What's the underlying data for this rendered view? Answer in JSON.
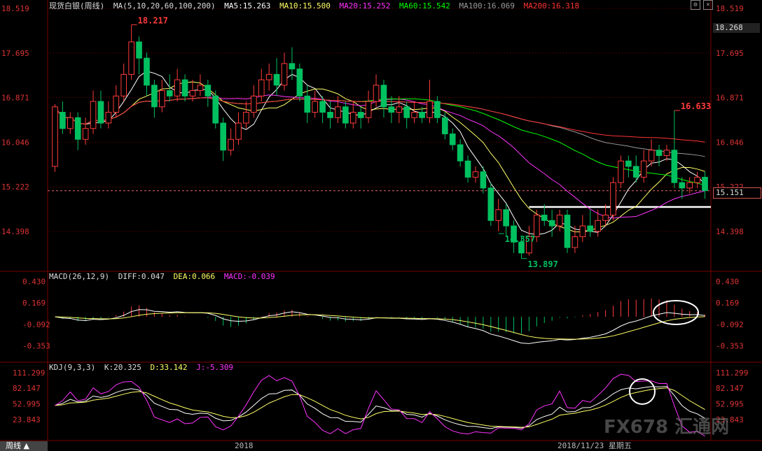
{
  "header": {
    "instrument": "现货白银(周线)",
    "ma_label": "MA(5,10,20,60,100,200)",
    "ma5": "MA5:15.263",
    "ma10": "MA10:15.500",
    "ma20": "MA20:15.252",
    "ma60": "MA60:15.542",
    "ma100": "MA100:16.069",
    "ma200": "MA200:16.318"
  },
  "macd_header": {
    "label": "MACD(26,12,9)",
    "diff": "DIFF:0.047",
    "dea": "DEA:0.066",
    "macd": "MACD:-0.039"
  },
  "kdj_header": {
    "label": "KDJ(9,3,3)",
    "k": "K:20.325",
    "d": "D:33.142",
    "j": "J:-5.309"
  },
  "price_tag": "15.151",
  "crosshair_value": "18.268",
  "bottom_tab": "周线 ▲",
  "xaxis": {
    "year": "2018",
    "date": "2018/11/23 星期五"
  },
  "watermark": "FX678 汇通网",
  "colors": {
    "up": "#ff3b3b",
    "down": "#00c060",
    "ma5": "#ffffff",
    "ma10": "#ffff66",
    "ma20": "#ff33ff",
    "ma60": "#00ff00",
    "ma100": "#999999",
    "ma200": "#ff3333",
    "grid": "#7a0000"
  },
  "chart_data": [
    {
      "type": "candlestick",
      "title": "现货白银(周线)",
      "yticks": [
        18.519,
        17.695,
        16.871,
        16.046,
        15.222,
        14.398
      ],
      "ylim": [
        13.7,
        18.519
      ],
      "annotations": [
        {
          "text": "18.217",
          "value": 18.217
        },
        {
          "text": "14.357",
          "value": 14.357
        },
        {
          "text": "13.897",
          "value": 13.897
        },
        {
          "text": "16.633",
          "value": 16.633
        }
      ],
      "support_line": 14.85,
      "reference_price": 15.151,
      "candles": [
        [
          15.6,
          16.7,
          16.75,
          15.5
        ],
        [
          16.6,
          16.3,
          16.8,
          16.2
        ],
        [
          16.3,
          16.5,
          16.6,
          16.2
        ],
        [
          16.5,
          16.1,
          16.6,
          15.9
        ],
        [
          16.1,
          16.3,
          16.5,
          16.0
        ],
        [
          16.3,
          16.8,
          17.0,
          16.2
        ],
        [
          16.8,
          16.4,
          17.0,
          16.3
        ],
        [
          16.4,
          16.6,
          16.8,
          16.3
        ],
        [
          16.6,
          16.9,
          17.1,
          16.5
        ],
        [
          16.9,
          17.3,
          17.5,
          16.8
        ],
        [
          17.3,
          17.9,
          18.217,
          17.2
        ],
        [
          17.9,
          17.6,
          18.0,
          17.3
        ],
        [
          17.6,
          17.1,
          17.7,
          16.9
        ],
        [
          17.1,
          16.7,
          17.2,
          16.5
        ],
        [
          16.7,
          17.0,
          17.2,
          16.6
        ],
        [
          17.0,
          16.9,
          17.3,
          16.8
        ],
        [
          16.9,
          17.2,
          17.4,
          16.8
        ],
        [
          17.2,
          16.9,
          17.3,
          16.8
        ],
        [
          16.9,
          17.0,
          17.2,
          16.8
        ],
        [
          17.0,
          17.1,
          17.3,
          16.9
        ],
        [
          17.1,
          16.9,
          17.2,
          16.7
        ],
        [
          16.9,
          16.4,
          17.0,
          16.3
        ],
        [
          16.4,
          15.9,
          16.5,
          15.7
        ],
        [
          15.9,
          16.1,
          16.3,
          15.8
        ],
        [
          16.1,
          16.4,
          16.6,
          16.0
        ],
        [
          16.4,
          16.6,
          16.8,
          16.3
        ],
        [
          16.6,
          16.9,
          17.1,
          16.5
        ],
        [
          16.9,
          17.2,
          17.4,
          16.8
        ],
        [
          17.2,
          17.3,
          17.5,
          17.0
        ],
        [
          17.3,
          17.1,
          17.6,
          16.9
        ],
        [
          17.1,
          17.5,
          17.7,
          17.0
        ],
        [
          17.5,
          17.4,
          17.8,
          17.2
        ],
        [
          17.4,
          16.9,
          17.5,
          16.8
        ],
        [
          16.9,
          16.6,
          17.1,
          16.4
        ],
        [
          16.6,
          16.8,
          17.0,
          16.5
        ],
        [
          16.8,
          16.6,
          16.9,
          16.4
        ],
        [
          16.6,
          16.5,
          16.8,
          16.3
        ],
        [
          16.5,
          16.7,
          16.9,
          16.4
        ],
        [
          16.7,
          16.4,
          16.8,
          16.3
        ],
        [
          16.4,
          16.6,
          16.8,
          16.3
        ],
        [
          16.6,
          16.5,
          16.7,
          16.3
        ],
        [
          16.5,
          16.8,
          17.0,
          16.4
        ],
        [
          16.8,
          17.1,
          17.3,
          16.7
        ],
        [
          17.1,
          16.7,
          17.2,
          16.5
        ],
        [
          16.7,
          16.6,
          16.9,
          16.4
        ],
        [
          16.6,
          16.7,
          16.9,
          16.4
        ],
        [
          16.7,
          16.5,
          16.8,
          16.3
        ],
        [
          16.5,
          16.6,
          16.8,
          16.4
        ],
        [
          16.6,
          16.5,
          16.7,
          16.4
        ],
        [
          16.5,
          16.8,
          17.2,
          16.4
        ],
        [
          16.8,
          16.5,
          16.9,
          16.4
        ],
        [
          16.5,
          16.2,
          16.6,
          16.1
        ],
        [
          16.2,
          16.0,
          16.3,
          15.9
        ],
        [
          16.0,
          15.7,
          16.1,
          15.6
        ],
        [
          15.7,
          15.4,
          15.8,
          15.3
        ],
        [
          15.4,
          15.5,
          15.6,
          15.3
        ],
        [
          15.5,
          15.2,
          15.6,
          15.1
        ],
        [
          15.2,
          14.6,
          15.3,
          14.5
        ],
        [
          14.6,
          14.8,
          15.0,
          14.4
        ],
        [
          14.8,
          14.5,
          14.9,
          14.3
        ],
        [
          14.5,
          14.2,
          14.6,
          14.0
        ],
        [
          14.2,
          14.0,
          14.3,
          13.9
        ],
        [
          14.0,
          14.3,
          14.5,
          13.95
        ],
        [
          14.3,
          14.7,
          14.8,
          14.2
        ],
        [
          14.7,
          14.6,
          14.9,
          14.5
        ],
        [
          14.6,
          14.5,
          14.8,
          14.3
        ],
        [
          14.5,
          14.7,
          14.8,
          14.4
        ],
        [
          14.7,
          14.1,
          14.8,
          14.0
        ],
        [
          14.1,
          14.3,
          14.5,
          14.0
        ],
        [
          14.3,
          14.5,
          14.7,
          14.2
        ],
        [
          14.5,
          14.4,
          14.8,
          14.3
        ],
        [
          14.4,
          14.6,
          14.8,
          14.3
        ],
        [
          14.6,
          14.7,
          14.9,
          14.5
        ],
        [
          14.7,
          15.3,
          15.4,
          14.6
        ],
        [
          15.3,
          15.7,
          15.8,
          15.2
        ],
        [
          15.7,
          15.6,
          15.8,
          15.4
        ],
        [
          15.6,
          15.4,
          15.8,
          15.3
        ],
        [
          15.4,
          15.7,
          15.9,
          15.3
        ],
        [
          15.7,
          15.9,
          16.1,
          15.6
        ],
        [
          15.9,
          15.8,
          16.0,
          15.6
        ],
        [
          15.8,
          15.9,
          16.0,
          15.7
        ],
        [
          15.9,
          15.3,
          16.633,
          15.2
        ],
        [
          15.3,
          15.2,
          15.4,
          15.0
        ],
        [
          15.2,
          15.3,
          15.4,
          15.1
        ],
        [
          15.3,
          15.4,
          15.5,
          15.2
        ],
        [
          15.4,
          15.151,
          15.5,
          15.0
        ]
      ]
    },
    {
      "type": "bar",
      "title": "MACD(26,12,9)",
      "yticks": [
        0.43,
        0.169,
        -0.092,
        -0.353
      ],
      "series": [
        {
          "name": "DIFF",
          "value": 0.047
        },
        {
          "name": "DEA",
          "value": 0.066
        },
        {
          "name": "MACD",
          "value": -0.039
        }
      ]
    },
    {
      "type": "line",
      "title": "KDJ(9,3,3)",
      "yticks": [
        111.299,
        82.147,
        52.995,
        23.843
      ],
      "series": [
        {
          "name": "K",
          "value": 20.325
        },
        {
          "name": "D",
          "value": 33.142
        },
        {
          "name": "J",
          "value": -5.309
        }
      ]
    }
  ]
}
